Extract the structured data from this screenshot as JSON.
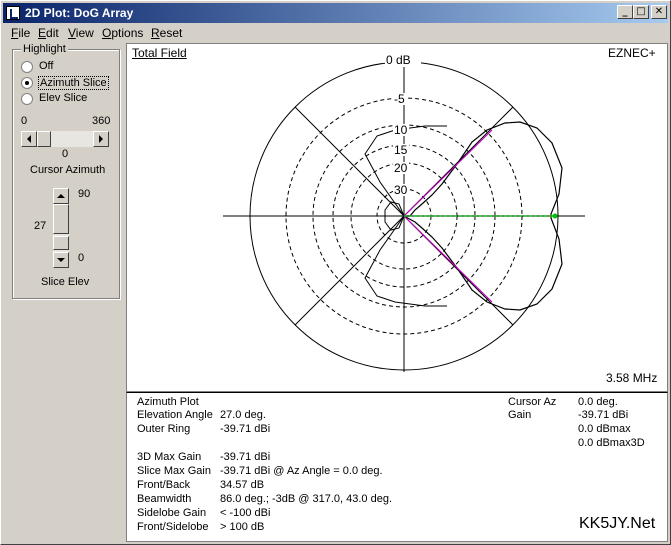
{
  "window": {
    "title": "2D Plot: DoG Array",
    "buttons": {
      "minimize": "_",
      "maximize": "□",
      "close": "✕"
    }
  },
  "menu": [
    "File",
    "Edit",
    "View",
    "Options",
    "Reset"
  ],
  "left_panel": {
    "highlight_label": "Highlight",
    "radios": [
      {
        "label": "Off",
        "selected": false
      },
      {
        "label": "Azimuth Slice",
        "selected": true
      },
      {
        "label": "Elev Slice",
        "selected": false
      }
    ],
    "az_min": "0",
    "az_max": "360",
    "az_value": "0",
    "cursor_az_label": "Cursor Azimuth",
    "elev_max": "90",
    "elev_value": "27",
    "elev_min": "0",
    "slice_elev_label": "Slice Elev"
  },
  "plot": {
    "title": "Total Field",
    "brand": "EZNEC+",
    "freq": "3.58 MHz",
    "ring_labels": [
      "0 dB",
      "-5",
      "10",
      "15",
      "20",
      "30"
    ]
  },
  "info": {
    "heading": "Azimuth Plot",
    "rows_left": [
      {
        "label": "Elevation Angle",
        "value": "27.0 deg."
      },
      {
        "label": "Outer Ring",
        "value": "-39.71 dBi"
      },
      {
        "label": "3D Max Gain",
        "value": "-39.71 dBi"
      },
      {
        "label": "Slice Max Gain",
        "value": "-39.71 dBi @ Az Angle = 0.0 deg."
      },
      {
        "label": "Front/Back",
        "value": "34.57 dB"
      },
      {
        "label": "Beamwidth",
        "value": "86.0 deg.; -3dB @ 317.0, 43.0 deg."
      },
      {
        "label": "Sidelobe Gain",
        "value": "< -100 dBi"
      },
      {
        "label": "Front/Sidelobe",
        "value": "> 100 dB"
      }
    ],
    "cursor_label": "Cursor Az",
    "cursor_value": "0.0 deg.",
    "gain_label": "Gain",
    "gain_values": [
      "-39.71 dBi",
      "0.0 dBmax",
      "0.0 dBmax3D"
    ],
    "watermark": "KK5JY.Net"
  },
  "colors": {
    "pattern": "#000000",
    "cursor": "#00c000",
    "beamwidth": "#c000c0"
  }
}
